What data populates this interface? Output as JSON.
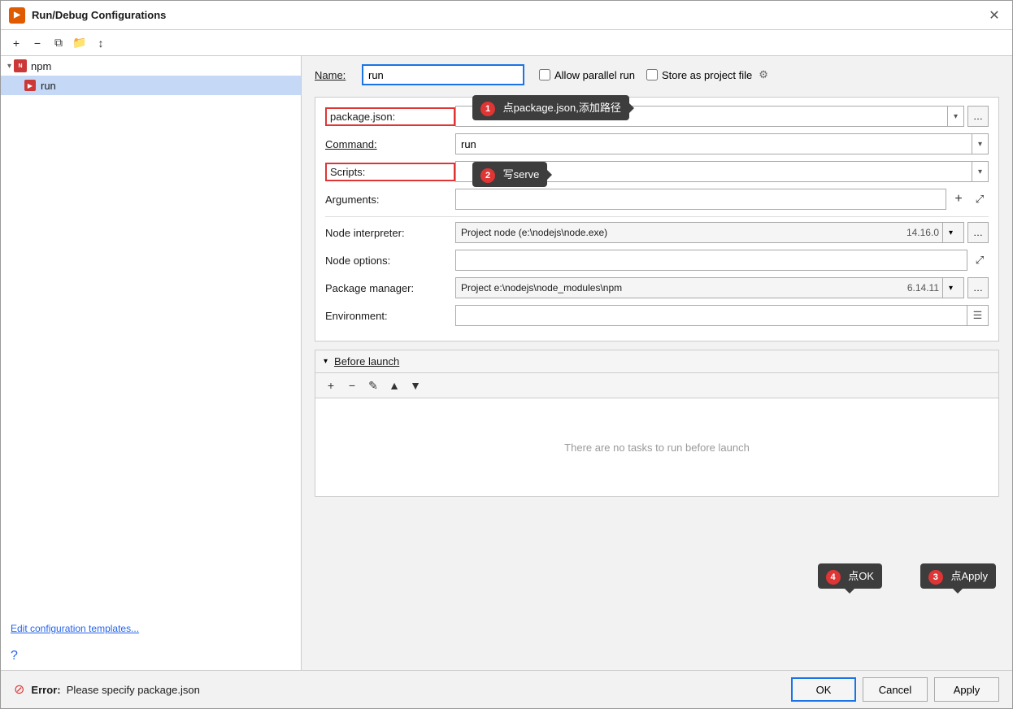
{
  "dialog": {
    "title": "Run/Debug Configurations",
    "close_label": "✕"
  },
  "toolbar": {
    "add_label": "+",
    "remove_label": "−",
    "copy_label": "⧉",
    "folder_label": "📁",
    "sort_label": "↕"
  },
  "tree": {
    "npm_label": "npm",
    "run_label": "run",
    "edit_templates_label": "Edit configuration templates..."
  },
  "header": {
    "name_label": "Name:",
    "name_value": "run",
    "allow_parallel_label": "Allow parallel run",
    "store_as_project_label": "Store as project file"
  },
  "form": {
    "package_json_label": "package.json:",
    "command_label": "Command:",
    "command_value": "run",
    "scripts_label": "Scripts:",
    "arguments_label": "Arguments:",
    "node_interpreter_label": "Node interpreter:",
    "node_interpreter_value": "Project  node (e:\\nodejs\\node.exe)",
    "node_version": "14.16.0",
    "node_options_label": "Node options:",
    "package_manager_label": "Package manager:",
    "package_manager_value": "Project  e:\\nodejs\\node_modules\\npm",
    "package_manager_version": "6.14.11",
    "environment_label": "Environment:"
  },
  "before_launch": {
    "label": "Before launch",
    "empty_text": "There are no tasks to run before launch"
  },
  "bottom": {
    "error_label": "Error:",
    "error_message": "Please specify package.json",
    "ok_label": "OK",
    "cancel_label": "Cancel",
    "apply_label": "Apply"
  },
  "annotations": {
    "bubble1_text": "点package.json,添加路径",
    "bubble2_text": "写serve",
    "bubble3_text": "点Apply",
    "bubble4_text": "点OK"
  },
  "steps": {
    "step1": "1",
    "step2": "2",
    "step3": "3",
    "step4": "4"
  }
}
